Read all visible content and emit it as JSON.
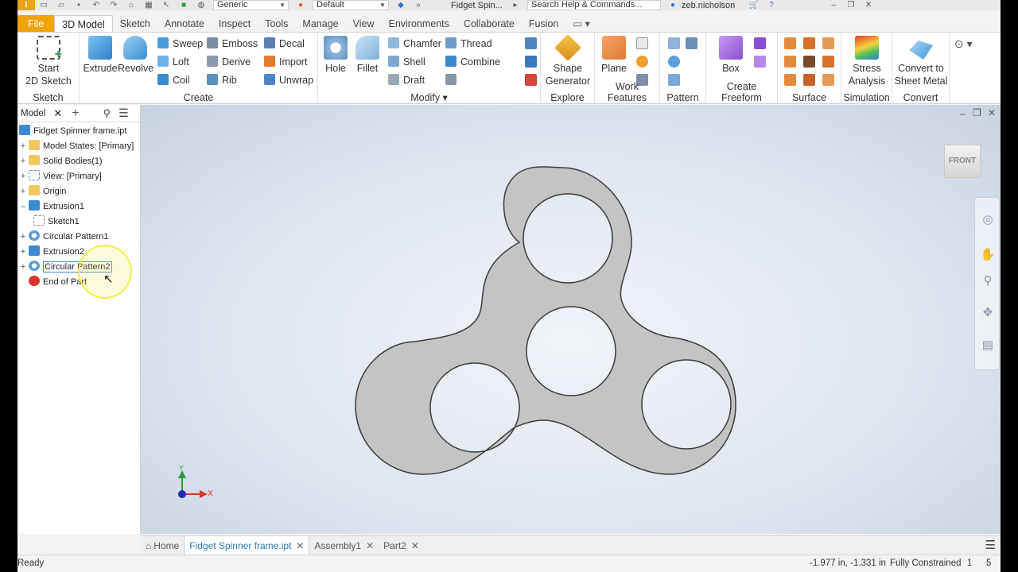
{
  "titlebar": {
    "appearance": "Generic",
    "material": "Default",
    "title": "Fidget Spin...",
    "search_placeholder": "Search Help & Commands...",
    "user": "zeb.nicholson"
  },
  "tabs": [
    "File",
    "3D Model",
    "Sketch",
    "Annotate",
    "Inspect",
    "Tools",
    "Manage",
    "View",
    "Environments",
    "Collaborate",
    "Fusion"
  ],
  "ribbon": {
    "sketch_panel": {
      "button_line1": "Start",
      "button_line2": "2D Sketch",
      "title": "Sketch"
    },
    "create_panel": {
      "title": "Create",
      "extrude": "Extrude",
      "revolve": "Revolve",
      "sweep": "Sweep",
      "loft": "Loft",
      "coil": "Coil",
      "emboss": "Emboss",
      "derive": "Derive",
      "rib": "Rib",
      "decal": "Decal",
      "import": "Import",
      "unwrap": "Unwrap"
    },
    "modify_panel": {
      "title": "Modify",
      "hole": "Hole",
      "fillet": "Fillet",
      "chamfer": "Chamfer",
      "shell": "Shell",
      "draft": "Draft",
      "thread": "Thread",
      "combine": "Combine"
    },
    "explore_panel": {
      "line1": "Shape",
      "line2": "Generator",
      "title": "Explore"
    },
    "work_panel": {
      "plane": "Plane",
      "title": "Work Features"
    },
    "pattern_panel": {
      "title": "Pattern"
    },
    "freeform_panel": {
      "box": "Box",
      "title": "Create Freeform"
    },
    "surface_panel": {
      "title": "Surface"
    },
    "simulation_panel": {
      "line1": "Stress",
      "line2": "Analysis",
      "title": "Simulation"
    },
    "convert_panel": {
      "line1": "Convert to",
      "line2": "Sheet Metal",
      "title": "Convert"
    }
  },
  "browser": {
    "tab": "Model",
    "items": [
      {
        "label": "Fidget Spinner frame.ipt"
      },
      {
        "label": "Model States: [Primary]"
      },
      {
        "label": "Solid Bodies(1)"
      },
      {
        "label": "View: [Primary]"
      },
      {
        "label": "Origin"
      },
      {
        "label": "Extrusion1"
      },
      {
        "label": "Sketch1"
      },
      {
        "label": "Circular Pattern1"
      },
      {
        "label": "Extrusion2"
      },
      {
        "label": "Circular Pattern2"
      },
      {
        "label": "End of Part"
      }
    ]
  },
  "viewport": {
    "viewcube_face": "FRONT",
    "triad_y": "Y",
    "triad_x": "X"
  },
  "doc_tabs": [
    {
      "label": "Home"
    },
    {
      "label": "Fidget Spinner frame.ipt"
    },
    {
      "label": "Assembly1"
    },
    {
      "label": "Part2"
    }
  ],
  "status": {
    "left": "Ready",
    "coords": "-1.977 in, -1.331 in",
    "constraint": "Fully Constrained",
    "count1": "1",
    "count2": "5"
  },
  "colors": {
    "file_tab": "#f0a30a",
    "part_gray": "#c4c4c4",
    "highlight_ring": "#f3ea39",
    "active_doc_tab": "#2779b8"
  }
}
